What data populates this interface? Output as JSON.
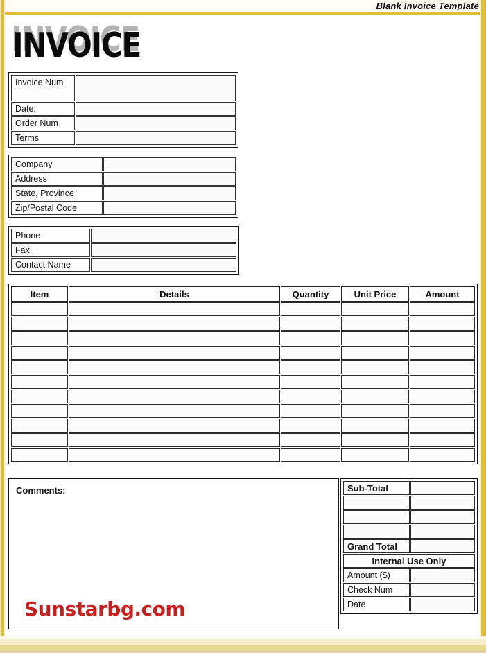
{
  "header": {
    "caption": "Blank Invoice Template"
  },
  "logo": {
    "text": "INVOICE"
  },
  "invoice_block": {
    "rows": [
      {
        "label": "Invoice Num",
        "value": ""
      },
      {
        "label": "Date:",
        "value": ""
      },
      {
        "label": "Order Num",
        "value": ""
      },
      {
        "label": "Terms",
        "value": ""
      }
    ]
  },
  "company_block": {
    "rows": [
      {
        "label": "Company",
        "value": ""
      },
      {
        "label": "Address",
        "value": ""
      },
      {
        "label": "State, Province",
        "value": ""
      },
      {
        "label": "Zip/Postal Code",
        "value": ""
      }
    ]
  },
  "contact_block": {
    "rows": [
      {
        "label": "Phone",
        "value": ""
      },
      {
        "label": "Fax",
        "value": ""
      },
      {
        "label": "Contact Name",
        "value": ""
      }
    ]
  },
  "items_table": {
    "columns": [
      "Item",
      "Details",
      "Quantity",
      "Unit Price",
      "Amount"
    ],
    "row_count": 11,
    "rows": [
      {
        "item": "",
        "details": "",
        "quantity": "",
        "unit_price": "",
        "amount": ""
      },
      {
        "item": "",
        "details": "",
        "quantity": "",
        "unit_price": "",
        "amount": ""
      },
      {
        "item": "",
        "details": "",
        "quantity": "",
        "unit_price": "",
        "amount": ""
      },
      {
        "item": "",
        "details": "",
        "quantity": "",
        "unit_price": "",
        "amount": ""
      },
      {
        "item": "",
        "details": "",
        "quantity": "",
        "unit_price": "",
        "amount": ""
      },
      {
        "item": "",
        "details": "",
        "quantity": "",
        "unit_price": "",
        "amount": ""
      },
      {
        "item": "",
        "details": "",
        "quantity": "",
        "unit_price": "",
        "amount": ""
      },
      {
        "item": "",
        "details": "",
        "quantity": "",
        "unit_price": "",
        "amount": ""
      },
      {
        "item": "",
        "details": "",
        "quantity": "",
        "unit_price": "",
        "amount": ""
      },
      {
        "item": "",
        "details": "",
        "quantity": "",
        "unit_price": "",
        "amount": ""
      },
      {
        "item": "",
        "details": "",
        "quantity": "",
        "unit_price": "",
        "amount": ""
      }
    ]
  },
  "comments": {
    "label": "Comments:",
    "value": ""
  },
  "watermark": {
    "text": "Sunstarbg.com",
    "color": "#c8201f"
  },
  "totals": {
    "rows": [
      {
        "label": "Sub-Total",
        "value": "",
        "bold": true
      },
      {
        "label": "",
        "value": "",
        "bold": false
      },
      {
        "label": "",
        "value": "",
        "bold": false
      },
      {
        "label": "",
        "value": "",
        "bold": false
      },
      {
        "label": "Grand Total",
        "value": "",
        "bold": true
      }
    ],
    "internal_header": "Internal Use Only",
    "internal_rows": [
      {
        "label": "Amount ($)",
        "value": ""
      },
      {
        "label": "Check Num",
        "value": ""
      },
      {
        "label": "Date",
        "value": ""
      }
    ]
  },
  "theme": {
    "border_color": "#e0bd33",
    "ink": "#111111",
    "accent_red": "#c8201f"
  }
}
